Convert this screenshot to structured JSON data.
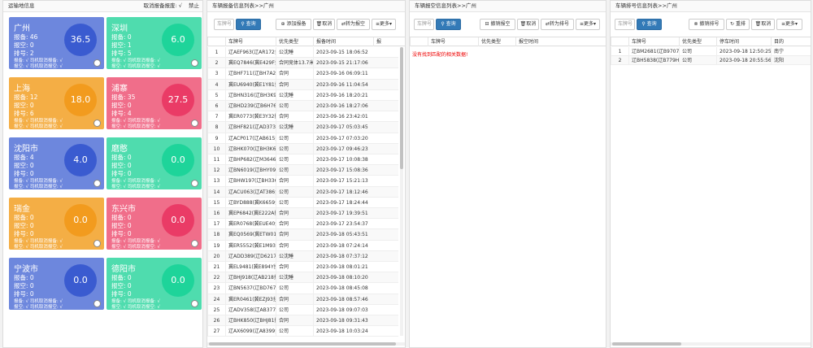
{
  "p1": {
    "title": "运输地信息",
    "cancel_label": "取消报备报废:",
    "cancel_value": "√",
    "disable_label": "禁止"
  },
  "colors": {
    "blue": "#6d87dd",
    "green": "#4fdcae",
    "orange": "#f4ae45",
    "pink": "#f06e8a"
  },
  "cards": [
    {
      "name": "广州",
      "l1": "报备: 46",
      "l2": "报空: 0",
      "l3": "排号: 2",
      "s1": "报备: √ 司机取消报备: √",
      "s2": "报空: √ 司机取消报空: √",
      "value": "36.5",
      "color": "blue",
      "circle": "#3a5bd0"
    },
    {
      "name": "深圳",
      "l1": "报备: 0",
      "l2": "报空: 1",
      "l3": "排号: 5",
      "s1": "报备: √ 司机取消报备: √",
      "s2": "报空: √ 司机取消报空: √",
      "value": "6.0",
      "color": "green",
      "circle": "#1ed49a"
    },
    {
      "name": "上海",
      "l1": "报备: 12",
      "l2": "报空: 0",
      "l3": "排号: 6",
      "s1": "报备: √ 司机取消报备: √",
      "s2": "报空: √ 司机取消报空: √",
      "value": "18.0",
      "color": "orange",
      "circle": "#f29b1e"
    },
    {
      "name": "浦寨",
      "l1": "报备: 35",
      "l2": "报空: 0",
      "l3": "排号: 4",
      "s1": "报备: √ 司机取消报备: √",
      "s2": "报空: √ 司机取消报空: √",
      "value": "27.5",
      "color": "pink",
      "circle": "#ea3b66"
    },
    {
      "name": "沈阳市",
      "l1": "报备: 4",
      "l2": "报空: 0",
      "l3": "排号: 0",
      "s1": "报备: √ 司机取消报备: √",
      "s2": "报空: √ 司机取消报空: √",
      "value": "4.0",
      "color": "blue",
      "circle": "#3a5bd0"
    },
    {
      "name": "磨憨",
      "l1": "报备: 0",
      "l2": "报空: 0",
      "l3": "排号: 0",
      "s1": "报备: √ 司机取消报备: √",
      "s2": "报空: √ 司机取消报空: √",
      "value": "0.0",
      "color": "green",
      "circle": "#1ed49a"
    },
    {
      "name": "瑞金",
      "l1": "报备: 0",
      "l2": "报空: 0",
      "l3": "排号: 0",
      "s1": "报备: √ 司机取消报备: √",
      "s2": "报空: √ 司机取消报空: √",
      "value": "0.0",
      "color": "orange",
      "circle": "#f29b1e"
    },
    {
      "name": "东兴市",
      "l1": "报备: 0",
      "l2": "报空: 0",
      "l3": "排号: 0",
      "s1": "报备: √ 司机取消报备: √",
      "s2": "报空: √ 司机取消报空: √",
      "value": "0.0",
      "color": "pink",
      "circle": "#ea3b66"
    },
    {
      "name": "宁波市",
      "l1": "报备: 0",
      "l2": "报空: 0",
      "l3": "排号: 0",
      "s1": "报备: √ 司机取消报备: √",
      "s2": "报空: √ 司机取消报空: √",
      "value": "0.0",
      "color": "blue",
      "circle": "#3a5bd0"
    },
    {
      "name": "德阳市",
      "l1": "报备: 0",
      "l2": "报空: 0",
      "l3": "排号: 0",
      "s1": "报备: √ 司机取消报备: √",
      "s2": "报空: √ 司机取消报空: √",
      "value": "0.0",
      "color": "green",
      "circle": "#1ed49a"
    }
  ],
  "p2": {
    "title": "车辆报备信息列表>>广州",
    "search_placeholder": "车牌号",
    "query_label": "查询",
    "add_label": "添加报备",
    "cancel_label": "取消",
    "to_empty_label": "转为报空",
    "more_label": "更多",
    "columns": [
      "",
      "车牌号",
      "优先类型",
      "报备时间",
      "报"
    ],
    "rows": [
      [
        "1",
        "辽AEF963(辽AR172挂)",
        "公沈睡",
        "2023-09-15 18:06:52"
      ],
      [
        "2",
        "冀EQ7846(冀E429F挂)",
        "合同竞体13.7米",
        "2023-09-15 21:17:06"
      ],
      [
        "3",
        "辽BHF711(辽BH7A2挂)",
        "合同",
        "2023-09-16 06:09:11"
      ],
      [
        "4",
        "冀EU6940(冀E1Y81挂)",
        "合同",
        "2023-09-16 11:04:54"
      ],
      [
        "5",
        "辽BHN316(辽BH3K9挂)",
        "公沈睡",
        "2023-09-16 18:20:21"
      ],
      [
        "6",
        "辽BHD239(辽B6H76挂)",
        "公司",
        "2023-09-16 18:27:06"
      ],
      [
        "7",
        "冀ER0773(冀E3Y32挂)",
        "合同",
        "2023-09-16 23:42:01"
      ],
      [
        "8",
        "辽BHF821(辽AD373挂)",
        "公沈睡",
        "2023-09-17 05:03:45"
      ],
      [
        "9",
        "辽ACP017(辽AB615挂)",
        "公司",
        "2023-09-17 07:03:20"
      ],
      [
        "10",
        "辽BHK070(辽BH3K6挂)",
        "公司",
        "2023-09-17 09:46:23"
      ],
      [
        "11",
        "辽BHP682(辽M3646挂)",
        "公司",
        "2023-09-17 10:08:38"
      ],
      [
        "12",
        "辽BN6019(辽BHY09挂)",
        "公司",
        "2023-09-17 15:08:36"
      ],
      [
        "13",
        "辽BHW197(辽BH3368挂)",
        "合同",
        "2023-09-17 15:21:13"
      ],
      [
        "14",
        "辽ACU063(辽AT386挂)",
        "公司",
        "2023-09-17 18:12:46"
      ],
      [
        "15",
        "辽BYD888(冀K6659挂)",
        "公司",
        "2023-09-17 18:24:44"
      ],
      [
        "16",
        "冀EP6842(冀E222A挂)",
        "合同",
        "2023-09-17 19:39:51"
      ],
      [
        "17",
        "冀ER0768(冀EUE40挂)",
        "合同",
        "2023-09-17 23:54:37"
      ],
      [
        "18",
        "冀EQ0569(冀ETW01挂)",
        "合同",
        "2023-09-18 05:43:51"
      ],
      [
        "19",
        "冀ER5552(冀E1M93挂)",
        "合同",
        "2023-09-18 07:24:14"
      ],
      [
        "20",
        "辽ADD389(辽D6217挂)",
        "公沈睡",
        "2023-09-18 07:37:12"
      ],
      [
        "21",
        "冀EL9481(冀E894Y挂)",
        "合同",
        "2023-09-18 08:01:21"
      ],
      [
        "22",
        "辽BHJ918(辽AB218挂)",
        "公沈睡",
        "2023-09-18 08:10:20"
      ],
      [
        "23",
        "辽BN5637(辽BD767挂)",
        "公司",
        "2023-09-18 08:45:08"
      ],
      [
        "24",
        "冀ER0461(冀EZJ93挂)",
        "合同",
        "2023-09-18 08:57:46"
      ],
      [
        "25",
        "辽ADV358(辽AB377挂)",
        "公司",
        "2023-09-18 09:07:03"
      ],
      [
        "26",
        "辽BHK850(辽BHJ81挂)",
        "合同",
        "2023-09-18 09:31:43"
      ],
      [
        "27",
        "辽AX6099(辽A8399挂)",
        "公司",
        "2023-09-18 10:03:24"
      ]
    ]
  },
  "p3": {
    "title": "车辆报空信息列表>>广州",
    "search_placeholder": "车牌号",
    "query_label": "查询",
    "revoke_label": "撤销报空",
    "cancel_label": "取消",
    "to_queue_label": "转为排号",
    "more_label": "更多",
    "columns": [
      "",
      "车牌号",
      "优先类型",
      "报空时间"
    ],
    "empty_message": "没有找到匹配的相关数据!"
  },
  "p4": {
    "title": "车辆排号信息列表>>广州",
    "search_placeholder": "车牌号",
    "query_label": "查询",
    "revoke_label": "撤销排号",
    "requeue_label": "重排",
    "cancel_label": "取消",
    "more_label": "更多",
    "columns": [
      "",
      "车牌号",
      "优先类型",
      "停车时间",
      "目的"
    ],
    "rows": [
      [
        "1",
        "辽BM2681(辽B9707挂)",
        "公司",
        "2023-09-18 12:50:25",
        "南宁"
      ],
      [
        "2",
        "辽BH5838(辽B779H挂)",
        "公司",
        "2023-09-18 20:55:56",
        "沈阳"
      ]
    ]
  }
}
